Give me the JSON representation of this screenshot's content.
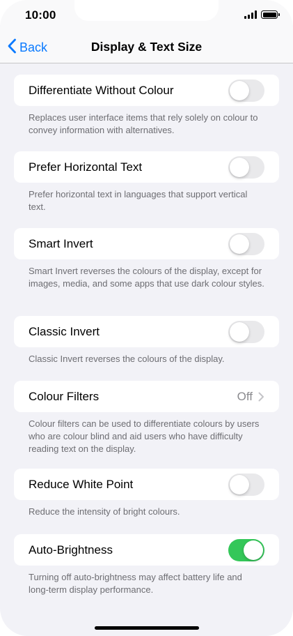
{
  "status_bar": {
    "time": "10:00"
  },
  "nav": {
    "back_label": "Back",
    "title": "Display & Text Size"
  },
  "settings": [
    {
      "label": "Differentiate Without Colour",
      "type": "toggle",
      "on": false,
      "footer": "Replaces user interface items that rely solely on colour to convey information with alternatives."
    },
    {
      "label": "Prefer Horizontal Text",
      "type": "toggle",
      "on": false,
      "footer": "Prefer horizontal text in languages that support vertical text."
    },
    {
      "label": "Smart Invert",
      "type": "toggle",
      "on": false,
      "footer": "Smart Invert reverses the colours of the display, except for images, media, and some apps that use dark colour styles."
    },
    {
      "label": "Classic Invert",
      "type": "toggle",
      "on": false,
      "footer": "Classic Invert reverses the colours of the display."
    },
    {
      "label": "Colour Filters",
      "type": "disclosure",
      "value": "Off",
      "footer": "Colour filters can be used to differentiate colours by users who are colour blind and aid users who have difficulty reading text on the display."
    },
    {
      "label": "Reduce White Point",
      "type": "toggle",
      "on": false,
      "footer": "Reduce the intensity of bright colours."
    },
    {
      "label": "Auto-Brightness",
      "type": "toggle",
      "on": true,
      "footer": "Turning off auto-brightness may affect battery life and long-term display performance."
    }
  ],
  "colors": {
    "accent": "#0a7aff",
    "toggle_on": "#34c759",
    "toggle_off": "#e9e9eb",
    "background": "#f2f2f7"
  },
  "icons": {
    "back": "chevron-left-icon",
    "disclosure": "chevron-right-icon",
    "signal": "cellular-signal-icon",
    "battery": "battery-icon"
  }
}
